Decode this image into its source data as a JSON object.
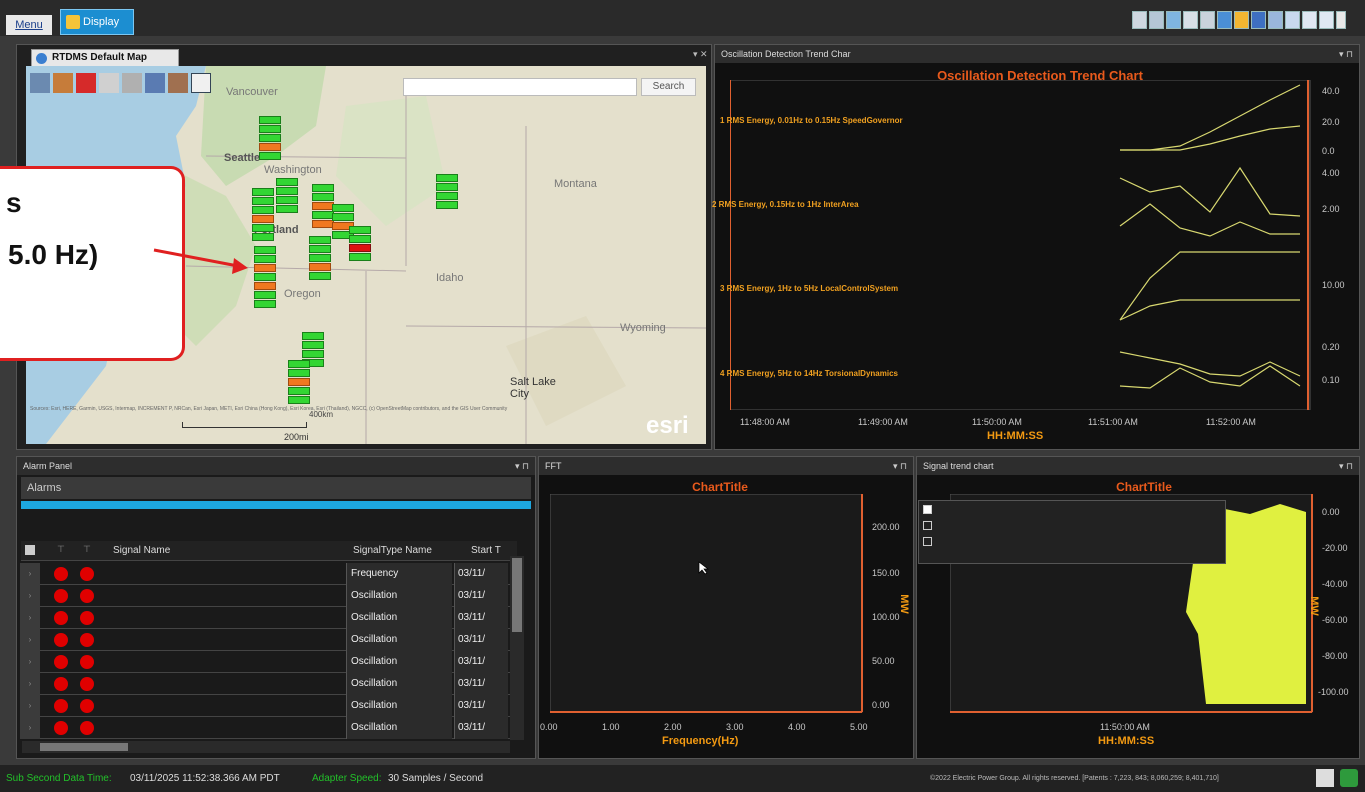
{
  "menubar": {
    "menu_label": "Menu",
    "display_label": "Display"
  },
  "map_panel": {
    "tab_title": "RTDMS Default Map",
    "search_placeholder": "",
    "search_button": "Search",
    "places": [
      "Vancouver",
      "Seattle",
      "Washington",
      "Montana",
      "Portland",
      "Oregon",
      "Idaho",
      "Wyoming",
      "Salt Lake City"
    ],
    "attribution": "Sources: Esri, HERE, Garmin, USGS, Intermap, INCREMENT P, NRCan, Esri Japan, METI, Esri China (Hong Kong), Esri Korea, Esri (Thailand), NGCC, (c) OpenStreetMap contributors, and the GIS User Community",
    "scale_top": "400km",
    "scale_bottom": "200mi",
    "logo": "esri"
  },
  "callout": {
    "line1": "s",
    "line2": "5.0 Hz)"
  },
  "osc_panel": {
    "header": "Oscillation Detection Trend Char",
    "title": "Oscillation Detection Trend Chart",
    "xlabel": "HH:MM:SS",
    "series_labels": [
      "1 RMS Energy,  0.01Hz to 0.15Hz SpeedGovernor",
      "2 RMS Energy,  0.15Hz to 1Hz InterArea",
      "3 RMS Energy,  1Hz to 5Hz LocalControlSystem",
      "4 RMS Energy,  5Hz to 14Hz TorsionalDynamics"
    ],
    "y_ticks": [
      "40.0",
      "20.0",
      "0.0",
      "4.00",
      "2.00",
      "10.00",
      "0.20",
      "0.10"
    ],
    "x_ticks": [
      "11:48:00 AM",
      "11:49:00 AM",
      "11:50:00 AM",
      "11:51:00 AM",
      "11:52:00 AM"
    ]
  },
  "alarm_panel": {
    "header": "Alarm Panel",
    "subheader": "Alarms",
    "columns": [
      "Signal Name",
      "SignalType Name",
      "Start T"
    ],
    "rows": [
      {
        "type": "Frequency",
        "start": "03/11/"
      },
      {
        "type": "Oscillation",
        "start": "03/11/"
      },
      {
        "type": "Oscillation",
        "start": "03/11/"
      },
      {
        "type": "Oscillation",
        "start": "03/11/"
      },
      {
        "type": "Oscillation",
        "start": "03/11/"
      },
      {
        "type": "Oscillation",
        "start": "03/11/"
      },
      {
        "type": "Oscillation",
        "start": "03/11/"
      },
      {
        "type": "Oscillation",
        "start": "03/11/"
      }
    ]
  },
  "fft_panel": {
    "header": "FFT",
    "title": "ChartTitle",
    "xlabel": "Frequency(Hz)",
    "ylabel": "MW",
    "x_ticks": [
      "0.00",
      "1.00",
      "2.00",
      "3.00",
      "4.00",
      "5.00"
    ],
    "y_ticks": [
      "200.00",
      "150.00",
      "100.00",
      "50.00",
      "0.00"
    ]
  },
  "trend_panel": {
    "header": "Signal trend chart",
    "title": "ChartTitle",
    "xlabel": "HH:MM:SS",
    "ylabel": "MW",
    "x_tick": "11:50:00 AM",
    "y_ticks": [
      "0.00",
      "-20.00",
      "-40.00",
      "-60.00",
      "-80.00",
      "-100.00"
    ]
  },
  "statusbar": {
    "time_label": "Sub Second Data Time:",
    "time_value": "03/11/2025 11:52:38.366 AM PDT",
    "speed_label": "Adapter Speed:",
    "speed_value": "30 Samples / Second",
    "copyright": "©2022 Electric Power Group. All rights reserved. [Patents : 7,223, 843; 8,060,259; 8,401,710]"
  },
  "colors": {
    "accent": "#1c8ed1",
    "chart_title": "#e85a1c",
    "axis": "#f39a12",
    "series": "#e8e870",
    "alarm": "#e00000"
  },
  "chart_data": [
    {
      "type": "line",
      "title": "Oscillation Detection Trend Chart",
      "xlabel": "HH:MM:SS",
      "x": [
        "11:51:00",
        "11:51:15",
        "11:51:30",
        "11:51:45",
        "11:52:00",
        "11:52:15",
        "11:52:30"
      ],
      "series": [
        {
          "name": "1 RMS Energy,  0.01Hz to 0.15Hz SpeedGovernor",
          "values": [
            0,
            0,
            2,
            15,
            30,
            40,
            45
          ]
        },
        {
          "name": "2 RMS Energy,  0.15Hz to 1Hz InterArea",
          "values": [
            3.9,
            3.3,
            3.7,
            2.1,
            4.1,
            2.0,
            1.9
          ]
        },
        {
          "name": "3 RMS Energy,  1Hz to 5Hz LocalControlSystem",
          "values": [
            4.5,
            7.0,
            7.2,
            7.2,
            7.1,
            7.1,
            7.2
          ]
        },
        {
          "name": "4 RMS Energy,  5Hz to 14Hz TorsionalDynamics",
          "values": [
            0.15,
            0.14,
            0.1,
            0.12,
            0.11,
            0.14,
            0.1
          ]
        }
      ]
    },
    {
      "type": "line",
      "title": "ChartTitle",
      "xlabel": "Frequency(Hz)",
      "ylabel": "MW",
      "xlim": [
        0,
        5
      ],
      "ylim": [
        0,
        220
      ],
      "series": []
    },
    {
      "type": "area",
      "title": "ChartTitle",
      "xlabel": "HH:MM:SS",
      "ylabel": "MW",
      "ylim": [
        -110,
        10
      ],
      "series": []
    }
  ]
}
